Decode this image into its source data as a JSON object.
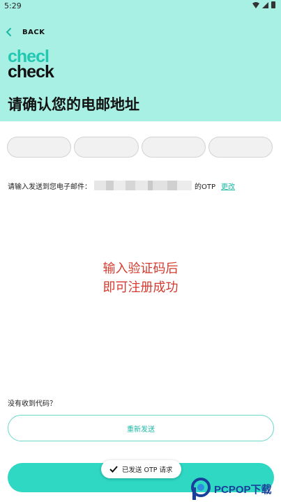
{
  "status_bar": {
    "time": "5:29"
  },
  "nav": {
    "back_label": "BACK"
  },
  "logo": {
    "line1": "checl",
    "line2": "check"
  },
  "title": "请确认您的电邮地址",
  "otp": {
    "box_count": 4
  },
  "sent_message": {
    "prefix": "请输入发送到您电子邮件：",
    "suffix": "的OTP",
    "change_link": "更改"
  },
  "overlay_note": {
    "line1": "输入验证码后",
    "line2": "即可注册成功"
  },
  "no_code_label": "没有收到代码？",
  "resend_button": "重新发送",
  "toast": {
    "text": "已发送 OTP 请求"
  },
  "watermark": {
    "text": "PCPOP下载"
  },
  "colors": {
    "accent": "#2ed8c3",
    "header_bg": "#a8efe4",
    "link": "#1cb8a4",
    "note": "#d43a2f"
  }
}
